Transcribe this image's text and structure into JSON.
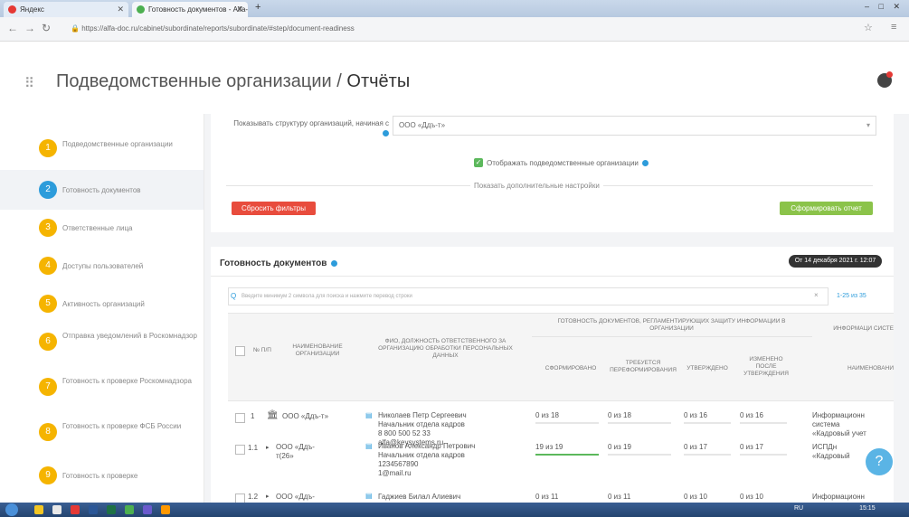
{
  "browser": {
    "tabs": [
      {
        "label": "Яндекс",
        "icon": "yandex-icon",
        "color": "#e53935"
      },
      {
        "label": "Готовность документов - Alfa-D",
        "icon": "site-icon",
        "color": "#4caf50"
      }
    ],
    "new_tab": "+",
    "url_host": "alfa-doc.ru",
    "url_full": "https://alfa-doc.ru/cabinet/subordinate/reports/subordinate/#step/document-readiness"
  },
  "header": {
    "section": "Подведомственные организации",
    "separator": "/",
    "current": "Отчёты"
  },
  "sidebar": {
    "items": [
      {
        "num": "1",
        "label": "Подведомственные организации",
        "color": "#f5b400"
      },
      {
        "num": "2",
        "label": "Готовность документов",
        "color": "#2d9cdb",
        "active": true
      },
      {
        "num": "3",
        "label": "Ответственные лица",
        "color": "#f5b400"
      },
      {
        "num": "4",
        "label": "Доступы пользователей",
        "color": "#f5b400"
      },
      {
        "num": "5",
        "label": "Активность организаций",
        "color": "#f5b400"
      },
      {
        "num": "6",
        "label": "Отправка уведомлений в Роскомнадзор",
        "color": "#f5b400"
      },
      {
        "num": "7",
        "label": "Готовность к проверке Роскомнадзора",
        "color": "#f5b400"
      },
      {
        "num": "8",
        "label": "Готовность к проверке ФСБ России",
        "color": "#f5b400"
      },
      {
        "num": "9",
        "label": "Готовность к проверке",
        "color": "#f5b400"
      }
    ]
  },
  "filters": {
    "structure_label": "Показывать структуру организаций, начиная с",
    "structure_value": "ООО «Ддъ-т»",
    "show_sub_label": "Отображать подведомственные организации",
    "more_settings": "Показать дополнительные настройки",
    "reset_button": "Сбросить фильтры",
    "build_button": "Сформировать отчет"
  },
  "report": {
    "title": "Готовность документов",
    "date_badge": "От 14 декабря 2021 г. 12:07",
    "search_placeholder": "Введите минимум 2 символа для поиска и нажмите перевод строки",
    "pager": "1-25 из 35",
    "columns": {
      "num": "№ п/п",
      "org": "Наименование организации",
      "person": "ФИО, должность ответственного за организацию обработки персональных данных",
      "group": "Готовность документов, регламентирующих защиту информации в организации",
      "formed": "Сформировано",
      "reform": "Требуется переформирования",
      "approved": "Утверждено",
      "changed": "Изменено после утверждения",
      "info_group": "Информаци систе",
      "info_name": "Наименовани"
    },
    "rows": [
      {
        "num": "1",
        "org": "ООО «Ддъ-т»",
        "person_lines": [
          "Николаев Петр Сергеевич",
          "Начальник отдела кадров",
          "8 800 500 52 33",
          "alfa@keysystems.ru"
        ],
        "formed": "0 из 18",
        "formed_pct": 0,
        "reform": "0 из 18",
        "approved": "0 из 16",
        "changed": "0 из 16",
        "info_lines": [
          "Информационн",
          "система",
          "«Кадровый учет"
        ]
      },
      {
        "num": "1.1",
        "org_lines": [
          "ООО «Ддъ-",
          "т(26»"
        ],
        "person_lines": [
          "Иванов Александр Петрович",
          "Начальник отдела кадров",
          "1234567890",
          "1@mail.ru"
        ],
        "formed": "19 из 19",
        "formed_pct": 100,
        "reform": "0 из 19",
        "approved": "0 из 17",
        "changed": "0 из 17",
        "info_lines": [
          "ИСПДн",
          "«Кадровый"
        ]
      },
      {
        "num": "1.2",
        "org_lines": [
          "ООО «Ддъ-"
        ],
        "person_lines": [
          "Гаджиев Билал Алиевич"
        ],
        "formed": "0 из 11",
        "formed_pct": 0,
        "reform": "0 из 11",
        "approved": "0 из 10",
        "changed": "0 из 10",
        "info_lines": [
          "Информационн"
        ]
      }
    ]
  },
  "help_label": "?",
  "taskbar": {
    "lang": "RU",
    "time": "15:15"
  }
}
